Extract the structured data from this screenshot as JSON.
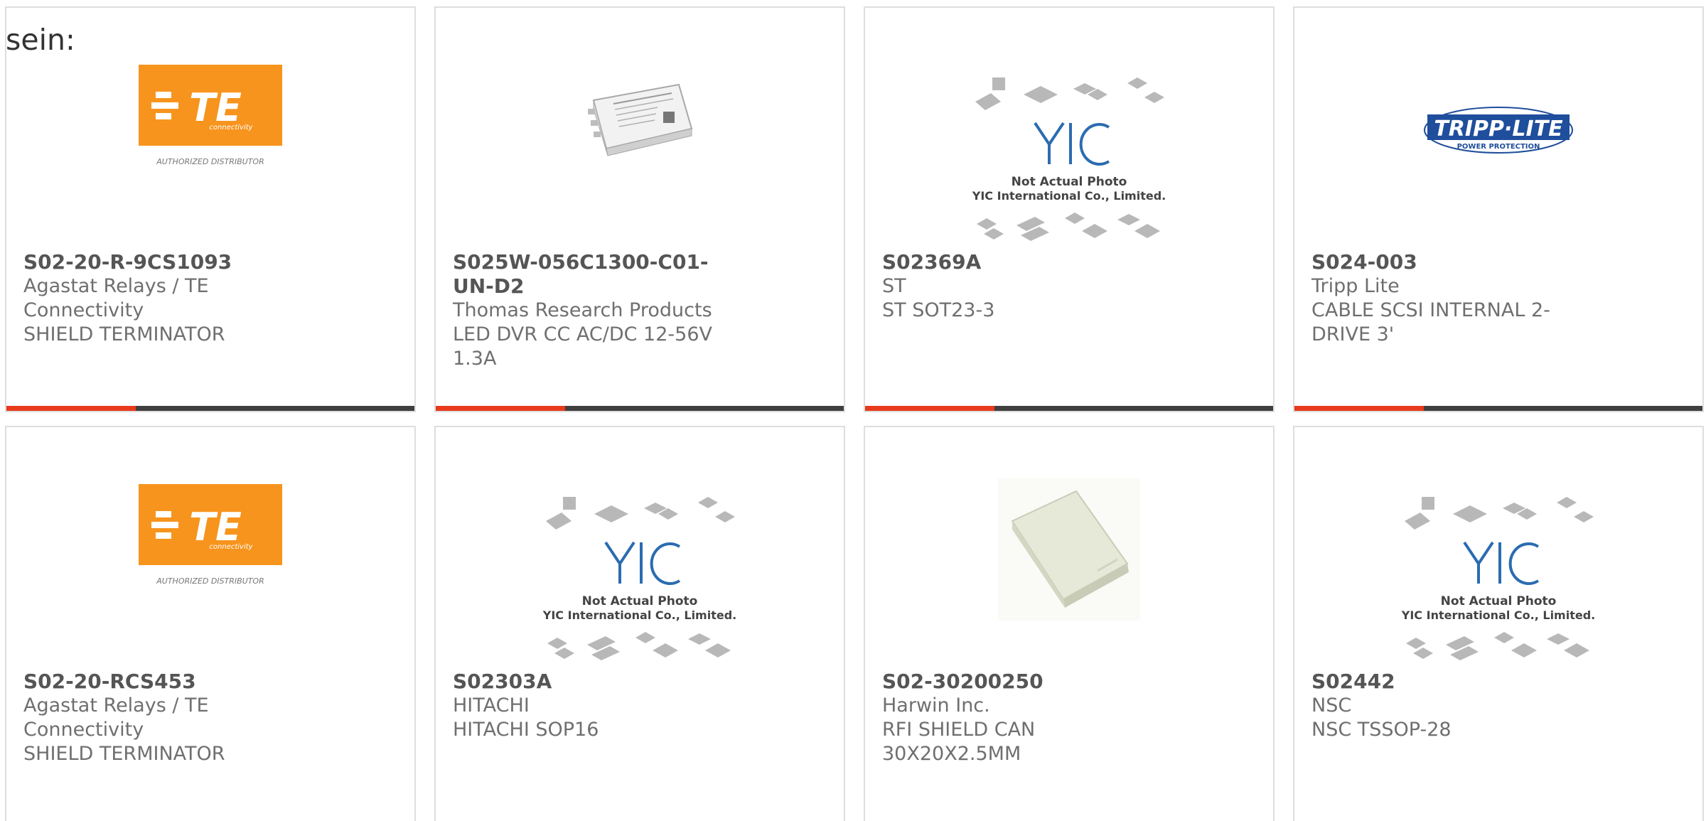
{
  "intro_text": "sein:",
  "accent_color": "#e8391d",
  "bar_color": "#3f3f3f",
  "products": [
    {
      "part_number": "S02-20-R-9CS1093",
      "manufacturer": "Agastat Relays / TE Connectivity",
      "description": "SHIELD TERMINATOR",
      "image": "te-connectivity-logo",
      "logo_text": "TE",
      "logo_subtext": "connectivity",
      "logo_caption": "AUTHORIZED DISTRIBUTOR"
    },
    {
      "part_number": "S025W-056C1300-C01-UN-D2",
      "manufacturer": "Thomas Research Products",
      "description": "LED DVR CC AC/DC 12-56V 1.3A",
      "image": "led-driver-photo"
    },
    {
      "part_number": "S02369A",
      "manufacturer": "ST",
      "description": "ST SOT23-3",
      "image": "yic-placeholder",
      "placeholder_line1": "Not Actual Photo",
      "placeholder_line2": "YIC International Co., Limited."
    },
    {
      "part_number": "S024-003",
      "manufacturer": "Tripp Lite",
      "description": "CABLE SCSI INTERNAL 2-DRIVE 3'",
      "image": "tripp-lite-logo",
      "logo_text": "TRIPP·LITE",
      "logo_subtext": "POWER PROTECTION"
    },
    {
      "part_number": "S02-20-RCS453",
      "manufacturer": "Agastat Relays / TE Connectivity",
      "description": "SHIELD TERMINATOR",
      "image": "te-connectivity-logo",
      "logo_text": "TE",
      "logo_subtext": "connectivity",
      "logo_caption": "AUTHORIZED DISTRIBUTOR"
    },
    {
      "part_number": "S02303A",
      "manufacturer": "HITACHI",
      "description": "HITACHI SOP16",
      "image": "yic-placeholder",
      "placeholder_line1": "Not Actual Photo",
      "placeholder_line2": "YIC International Co., Limited."
    },
    {
      "part_number": "S02-30200250",
      "manufacturer": "Harwin Inc.",
      "description": "RFI SHIELD CAN 30X20X2.5MM",
      "image": "shield-can-photo"
    },
    {
      "part_number": "S02442",
      "manufacturer": "NSC",
      "description": "NSC TSSOP-28",
      "image": "yic-placeholder",
      "placeholder_line1": "Not Actual Photo",
      "placeholder_line2": "YIC International Co., Limited."
    }
  ]
}
